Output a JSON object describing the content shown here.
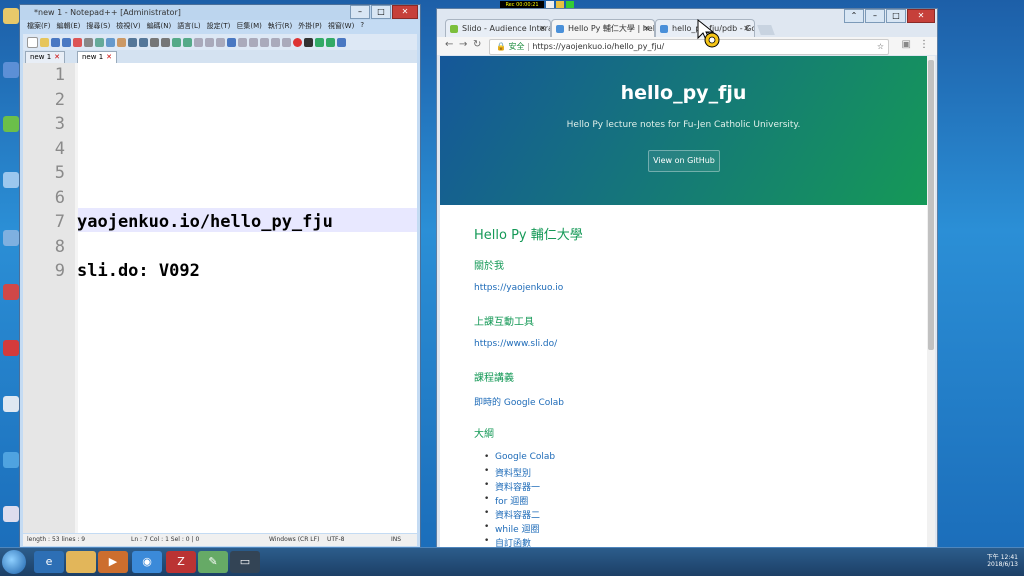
{
  "notepad": {
    "title": "*new 1 - Notepad++ [Administrator]",
    "menu": [
      "檔案(F)",
      "編輯(E)",
      "搜尋(S)",
      "檢視(V)",
      "編碼(N)",
      "語言(L)",
      "設定(T)",
      "巨集(M)",
      "執行(R)",
      "外掛(P)",
      "視窗(W)",
      "?"
    ],
    "tabs": [
      "new 1",
      "new 1"
    ],
    "lines": [
      {
        "num": "1",
        "text": ""
      },
      {
        "num": "2",
        "text": ""
      },
      {
        "num": "3",
        "text": ""
      },
      {
        "num": "4",
        "text": ""
      },
      {
        "num": "5",
        "text": ""
      },
      {
        "num": "6",
        "text": ""
      },
      {
        "num": "7",
        "text": "yaojenkuo.io/hello_py_fju"
      },
      {
        "num": "8",
        "text": ""
      },
      {
        "num": "9",
        "text": "sli.do: V092"
      }
    ],
    "status": {
      "length": "length : 53   lines : 9",
      "pos": "Ln : 7   Col : 1   Sel : 0 | 0",
      "eol": "Windows (CR LF)",
      "enc": "UTF-8",
      "ins": "INS"
    }
  },
  "chrome": {
    "tabs": [
      {
        "label": "Slido - Audience Intera",
        "color": "#7cbf3c"
      },
      {
        "label": "Hello Py 輔仁大學 | hello",
        "color": "#4a90d9"
      },
      {
        "label": "hello_py_fju/pdb - Go",
        "color": "#4a90d9"
      }
    ],
    "secure": "安全",
    "url": "https://yaojenkuo.io/hello_py_fju/",
    "hero": {
      "title": "hello_py_fju",
      "subtitle": "Hello Py lecture notes for Fu-Jen Catholic University.",
      "button": "View on GitHub"
    },
    "content": {
      "heading": "Hello Py 輔仁大學",
      "sections": [
        {
          "title": "關於我",
          "link": "https://yaojenkuo.io"
        },
        {
          "title": "上課互動工具",
          "link": "https://www.sli.do/"
        },
        {
          "title": "課程講義",
          "link": "即時的 Google Colab"
        }
      ],
      "outline_title": "大綱",
      "outline": [
        "Google Colab",
        "資料型別",
        "資料容器一",
        "for 迴圈",
        "資料容器二",
        "while 迴圈",
        "自訂函數"
      ]
    }
  },
  "recorder": {
    "label": "Rec 00:00:21"
  },
  "taskbar": {
    "time": "下午 12:41",
    "date": "2018/6/13"
  }
}
